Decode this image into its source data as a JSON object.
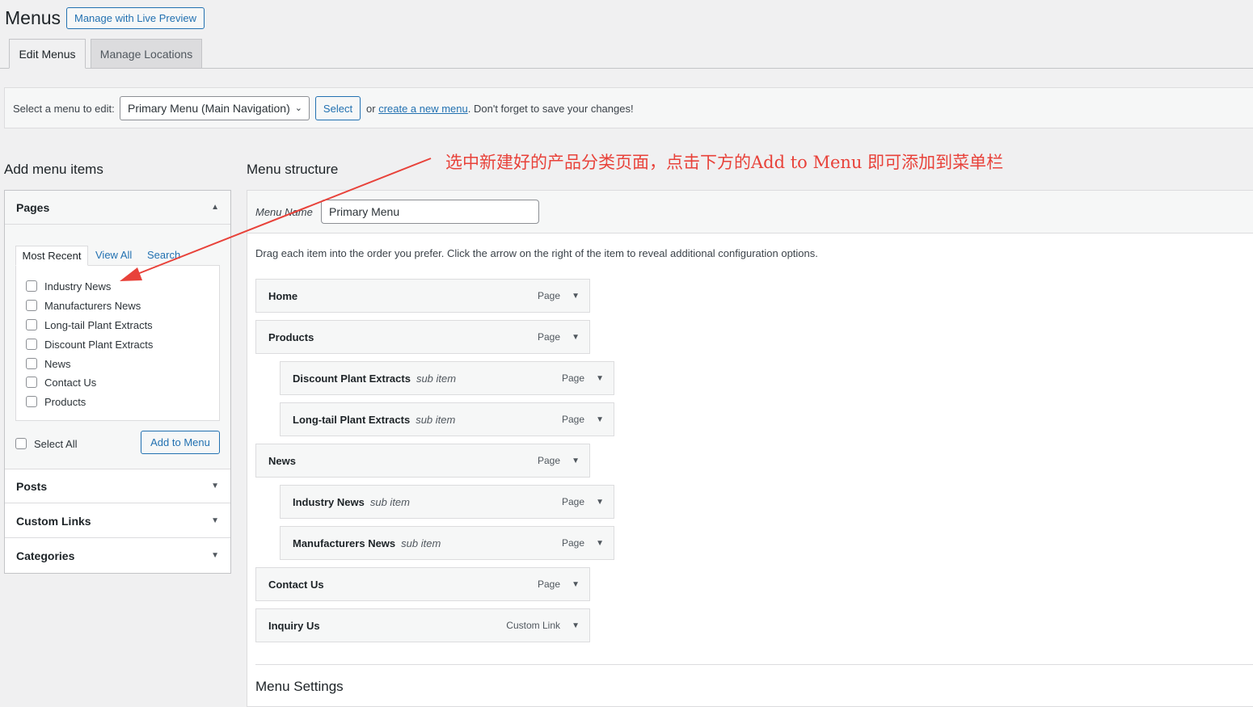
{
  "header": {
    "title": "Menus",
    "live_preview": "Manage with Live Preview"
  },
  "tabs": [
    {
      "label": "Edit Menus"
    },
    {
      "label": "Manage Locations"
    }
  ],
  "select_bar": {
    "label": "Select a menu to edit:",
    "selected": "Primary Menu (Main Navigation)",
    "button": "Select",
    "hint_prefix": "or",
    "create_link": "create a new menu",
    "hint_suffix": ". Don't forget to save your changes!"
  },
  "add_items": {
    "title": "Add menu items",
    "pages": {
      "title": "Pages",
      "tabs": [
        "Most Recent",
        "View All",
        "Search"
      ],
      "items": [
        "Industry News",
        "Manufacturers News",
        "Long-tail Plant Extracts",
        "Discount Plant Extracts",
        "News",
        "Contact Us",
        "Products"
      ],
      "select_all": "Select All",
      "add_button": "Add to Menu"
    },
    "sections": [
      "Posts",
      "Custom Links",
      "Categories"
    ]
  },
  "structure": {
    "title": "Menu structure",
    "menu_name_label": "Menu Name",
    "menu_name": "Primary Menu",
    "hint": "Drag each item into the order you prefer. Click the arrow on the right of the item to reveal additional configuration options.",
    "items": [
      {
        "title": "Home",
        "type": "Page",
        "sub": ""
      },
      {
        "title": "Products",
        "type": "Page",
        "sub": ""
      },
      {
        "title": "Discount Plant Extracts",
        "type": "Page",
        "sub": "sub item"
      },
      {
        "title": "Long-tail Plant Extracts",
        "type": "Page",
        "sub": "sub item"
      },
      {
        "title": "News",
        "type": "Page",
        "sub": ""
      },
      {
        "title": "Industry News",
        "type": "Page",
        "sub": "sub item"
      },
      {
        "title": "Manufacturers News",
        "type": "Page",
        "sub": "sub item"
      },
      {
        "title": "Contact Us",
        "type": "Page",
        "sub": ""
      },
      {
        "title": "Inquiry Us",
        "type": "Custom Link",
        "sub": ""
      }
    ],
    "settings_title": "Menu Settings"
  },
  "annotation": {
    "text": "选中新建好的产品分类页面，点击下方的Add to Menu 即可添加到菜单栏",
    "color": "#e8423a"
  },
  "icons": {
    "collapse": "triangle-up-icon",
    "expand": "triangle-down-icon",
    "select": "chevron-down-icon"
  }
}
